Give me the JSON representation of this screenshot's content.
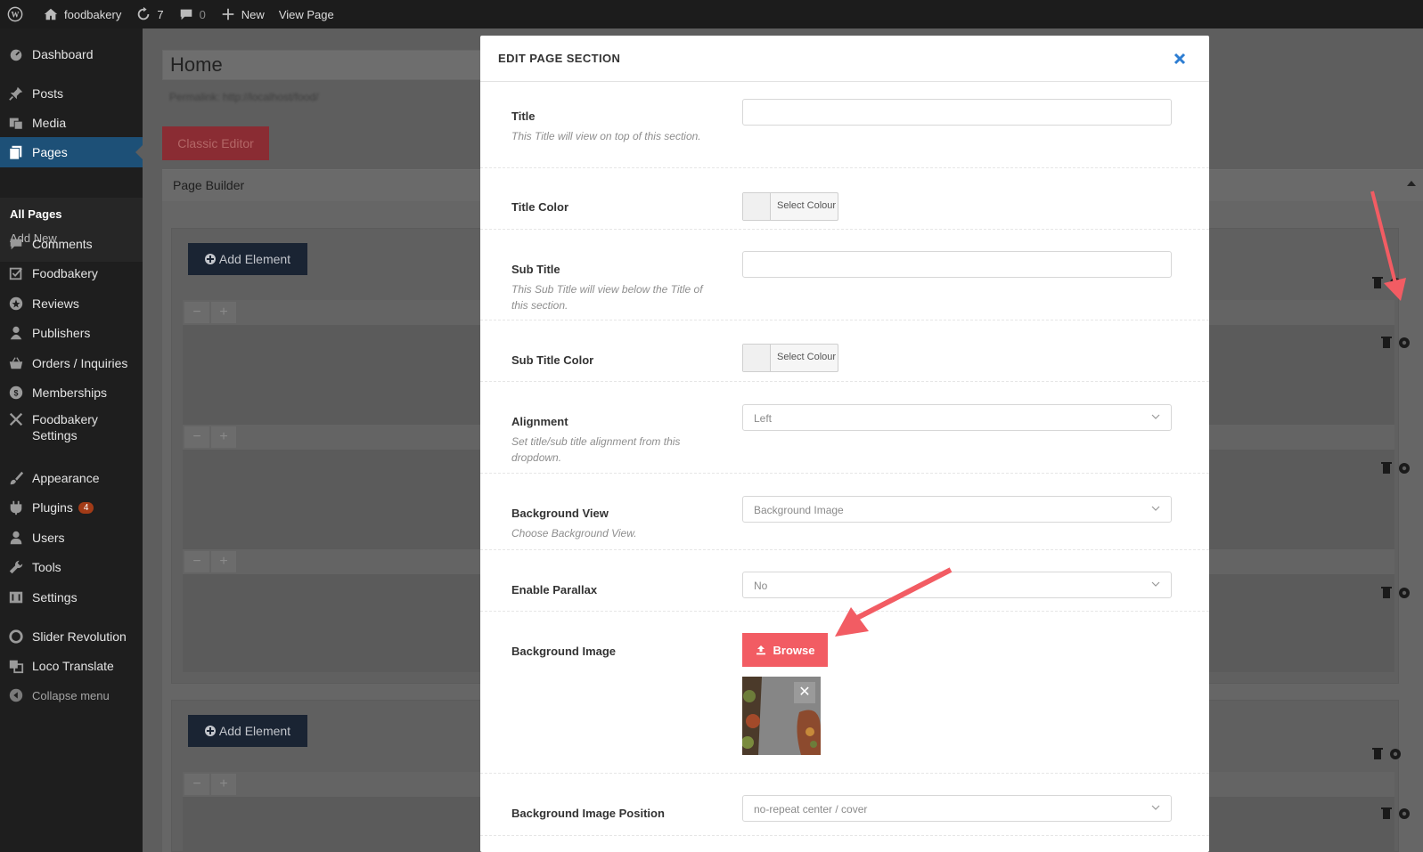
{
  "admin_bar": {
    "site_name": "foodbakery",
    "updates_count": "7",
    "comments_count": "0",
    "new_label": "New",
    "view_page_label": "View Page"
  },
  "sidebar": {
    "items": [
      {
        "label": "Dashboard",
        "icon": "dashboard-icon"
      },
      {
        "label": "Posts",
        "icon": "pin-icon"
      },
      {
        "label": "Media",
        "icon": "media-icon"
      },
      {
        "label": "Pages",
        "icon": "pages-icon"
      },
      {
        "label": "Comments",
        "icon": "comment-icon"
      },
      {
        "label": "Foodbakery",
        "icon": "foodbakery-icon"
      },
      {
        "label": "Reviews",
        "icon": "star-icon"
      },
      {
        "label": "Publishers",
        "icon": "publishers-icon"
      },
      {
        "label": "Orders / Inquiries",
        "icon": "basket-icon"
      },
      {
        "label": "Memberships",
        "icon": "membership-icon"
      },
      {
        "label": "Foodbakery Settings",
        "icon": "tools-icon"
      },
      {
        "label": "Appearance",
        "icon": "brush-icon"
      },
      {
        "label": "Plugins",
        "icon": "plugin-icon",
        "badge": "4"
      },
      {
        "label": "Users",
        "icon": "user-icon"
      },
      {
        "label": "Tools",
        "icon": "wrench-icon"
      },
      {
        "label": "Settings",
        "icon": "settings-icon"
      },
      {
        "label": "Slider Revolution",
        "icon": "revolution-icon"
      },
      {
        "label": "Loco Translate",
        "icon": "translate-icon"
      },
      {
        "label": "Collapse menu",
        "icon": "collapse-icon"
      }
    ],
    "submenu": {
      "all_pages": "All Pages",
      "add_new": "Add New"
    }
  },
  "editor": {
    "page_title": "Home",
    "permalink": "Permalink: http://localhost/food/",
    "classic_editor_label": "Classic Editor",
    "page_builder_label": "Page Builder",
    "add_element_label": "Add Element"
  },
  "modal": {
    "title": "EDIT PAGE SECTION",
    "fields": {
      "title": {
        "label": "Title",
        "desc": "This Title will view on top of this section.",
        "value": ""
      },
      "title_color": {
        "label": "Title Color",
        "button": "Select Colour"
      },
      "sub_title": {
        "label": "Sub Title",
        "desc": "This Sub Title will view below the Title of this section.",
        "value": ""
      },
      "sub_title_color": {
        "label": "Sub Title Color",
        "button": "Select Colour"
      },
      "alignment": {
        "label": "Alignment",
        "desc": "Set title/sub title alignment from this dropdown.",
        "value": "Left"
      },
      "background_view": {
        "label": "Background View",
        "desc": "Choose Background View.",
        "value": "Background Image"
      },
      "enable_parallax": {
        "label": "Enable Parallax",
        "value": "No"
      },
      "background_image": {
        "label": "Background Image",
        "button": "Browse"
      },
      "background_image_position": {
        "label": "Background Image Position",
        "value": "no-repeat center / cover"
      }
    }
  },
  "colors": {
    "accent_red": "#f25c63",
    "active_menu": "#1d5077",
    "annotation_arrow": "#f25c63",
    "modal_close": "#2d7dd2"
  }
}
